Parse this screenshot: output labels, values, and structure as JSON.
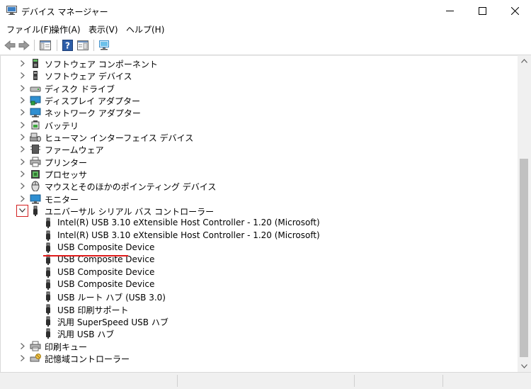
{
  "window": {
    "title": "デバイス マネージャー"
  },
  "menu": [
    "ファイル(F)",
    "操作(A)",
    "表示(V)",
    "ヘルプ(H)"
  ],
  "tree": [
    {
      "label": "ソフトウェア コンポーネント",
      "icon": "software-component-icon",
      "expander": "collapsed",
      "level": 1
    },
    {
      "label": "ソフトウェア デバイス",
      "icon": "software-device-icon",
      "expander": "collapsed",
      "level": 1
    },
    {
      "label": "ディスク ドライブ",
      "icon": "disk-drive-icon",
      "expander": "collapsed",
      "level": 1
    },
    {
      "label": "ディスプレイ アダプター",
      "icon": "display-adapter-icon",
      "expander": "collapsed",
      "level": 1
    },
    {
      "label": "ネットワーク アダプター",
      "icon": "network-adapter-icon",
      "expander": "collapsed",
      "level": 1
    },
    {
      "label": "バッテリ",
      "icon": "battery-icon",
      "expander": "collapsed",
      "level": 1
    },
    {
      "label": "ヒューマン インターフェイス デバイス",
      "icon": "hid-icon",
      "expander": "collapsed",
      "level": 1
    },
    {
      "label": "ファームウェア",
      "icon": "firmware-icon",
      "expander": "collapsed",
      "level": 1
    },
    {
      "label": "プリンター",
      "icon": "printer-icon",
      "expander": "collapsed",
      "level": 1
    },
    {
      "label": "プロセッサ",
      "icon": "processor-icon",
      "expander": "collapsed",
      "level": 1
    },
    {
      "label": "マウスとそのほかのポインティング デバイス",
      "icon": "mouse-icon",
      "expander": "collapsed",
      "level": 1
    },
    {
      "label": "モニター",
      "icon": "monitor-icon",
      "expander": "collapsed",
      "level": 1
    },
    {
      "label": "ユニバーサル シリアル バス コントローラー",
      "icon": "usb-icon",
      "expander": "expanded",
      "level": 1
    },
    {
      "label": "Intel(R) USB 3.10 eXtensible Host Controller - 1.20 (Microsoft)",
      "icon": "usb-icon",
      "level": 2
    },
    {
      "label": "Intel(R) USB 3.10 eXtensible Host Controller - 1.20 (Microsoft)",
      "icon": "usb-icon",
      "level": 2
    },
    {
      "label": "USB Composite Device",
      "icon": "usb-icon",
      "level": 2
    },
    {
      "label": "USB Composite Device",
      "icon": "usb-icon",
      "level": 2
    },
    {
      "label": "USB Composite Device",
      "icon": "usb-icon",
      "level": 2
    },
    {
      "label": "USB Composite Device",
      "icon": "usb-icon",
      "level": 2
    },
    {
      "label": "USB ルート ハブ (USB 3.0)",
      "icon": "usb-icon",
      "level": 2
    },
    {
      "label": "USB 印刷サポート",
      "icon": "usb-icon",
      "level": 2,
      "highlight": true
    },
    {
      "label": "汎用 SuperSpeed USB ハブ",
      "icon": "usb-icon",
      "level": 2
    },
    {
      "label": "汎用 USB ハブ",
      "icon": "usb-icon",
      "level": 2
    },
    {
      "label": "印刷キュー",
      "icon": "print-queue-icon",
      "expander": "collapsed",
      "level": 1
    },
    {
      "label": "記憶域コントローラー",
      "icon": "storage-controller-icon",
      "expander": "collapsed",
      "level": 1
    }
  ],
  "colors": {
    "highlight_underline": "#e01b1b",
    "expander_box": "#d32020"
  }
}
